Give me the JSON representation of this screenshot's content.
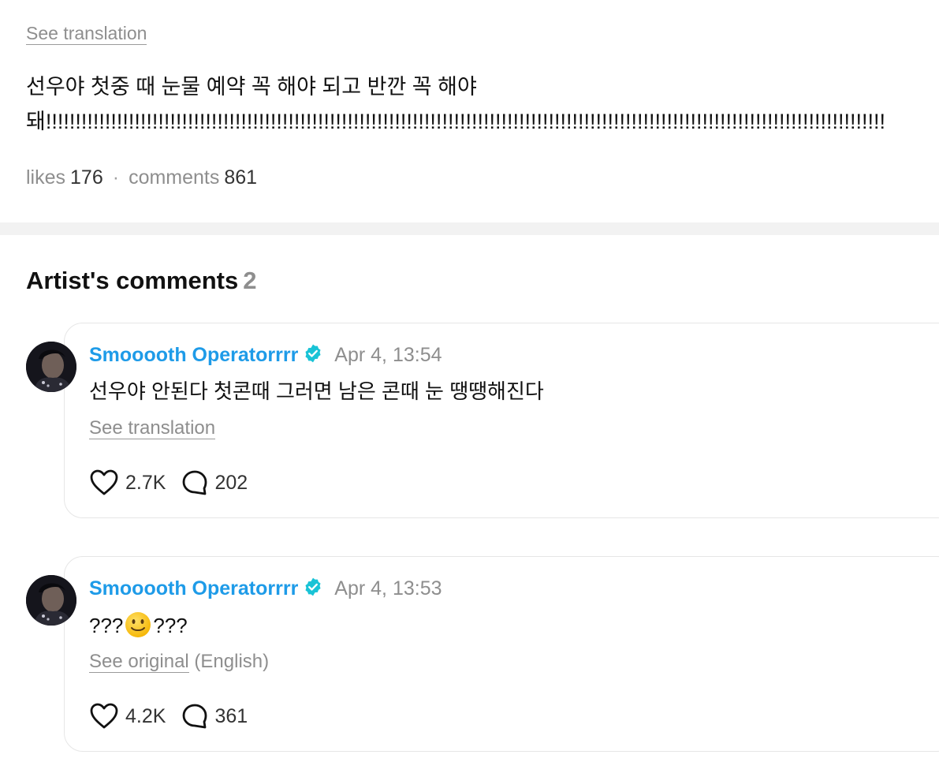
{
  "post": {
    "see_translation": "See translation",
    "body": "선우야 첫중 때 눈물 예약 꼭 해야 되고 반깐 꼭 해야 돼!!!!!!!!!!!!!!!!!!!!!!!!!!!!!!!!!!!!!!!!!!!!!!!!!!!!!!!!!!!!!!!!!!!!!!!!!!!!!!!!!!!!!!!!!!!!!!!!!!!!!!!!!!!!!!!!!!!!!!!!!!!!!!!!!!!!!!!!!!!!!!",
    "likes_label": "likes",
    "likes_count": "176",
    "separator": "·",
    "comments_label": "comments",
    "comments_count": "861"
  },
  "artist_comments": {
    "heading": "Artist's comments",
    "count": "2",
    "items": [
      {
        "author": "Smooooth Operatorrrr",
        "time": "Apr 4, 13:54",
        "text": "선우야 안된다 첫콘때 그러면 남은 콘때 눈 땡땡해진다",
        "link": "See translation",
        "link_suffix": "",
        "likes": "2.7K",
        "replies": "202"
      },
      {
        "author": "Smooooth Operatorrrr",
        "time": "Apr 4, 13:53",
        "text_before": "???",
        "emoji": "slightly-smiling-face-emoji",
        "text_after": "???",
        "link": "See original",
        "link_suffix": " (English)",
        "likes": "4.2K",
        "replies": "361"
      }
    ]
  },
  "colors": {
    "author": "#1e9be8",
    "verified": "#19c3d6",
    "muted": "#8e8e8e",
    "divider": "#f2f2f2"
  },
  "icons": {
    "verified": "verified-badge-icon",
    "like": "heart-icon",
    "reply": "comment-bubble-icon"
  }
}
